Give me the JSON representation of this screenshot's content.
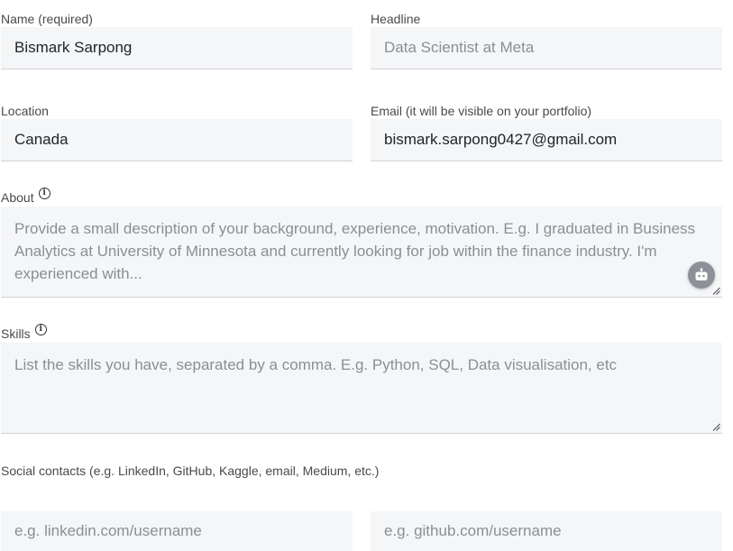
{
  "name": {
    "label": "Name (required)",
    "value": "Bismark Sarpong"
  },
  "headline": {
    "label": "Headline",
    "placeholder": "Data Scientist at Meta"
  },
  "location": {
    "label": "Location",
    "value": "Canada"
  },
  "email": {
    "label": "Email (it will be visible on your portfolio)",
    "value": "bismark.sarpong0427@gmail.com"
  },
  "about": {
    "label": "About",
    "placeholder": "Provide a small description of your background, experience, motivation. E.g. I graduated in Business Analytics at University of Minnesota and currently looking for job within the finance industry. I'm experienced with..."
  },
  "skills": {
    "label": "Skills",
    "placeholder": "List the skills you have, separated by a comma. E.g. Python, SQL, Data visualisation, etc"
  },
  "social": {
    "label": "Social contacts (e.g. LinkedIn, GitHub, Kaggle, email, Medium, etc.)",
    "linkedin_placeholder": "e.g. linkedin.com/username",
    "github_placeholder": "e.g. github.com/username"
  },
  "icons": {
    "info": "info-icon",
    "assistant": "robot-icon",
    "resize": "resize-handle-icon"
  }
}
